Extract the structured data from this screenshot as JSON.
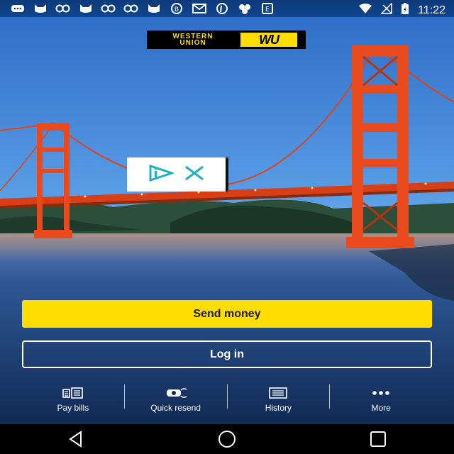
{
  "status_bar": {
    "time": "11:22",
    "notification_icons": [
      "message-icon",
      "cat-icon",
      "app-90-icon",
      "cat-icon",
      "app-90-icon",
      "app-90-icon",
      "cat-icon",
      "b-icon",
      "mail-icon",
      "pinterest-icon",
      "cluster-icon",
      "e-icon"
    ],
    "right_icons": [
      "wifi-icon",
      "signal-icon",
      "battery-icon"
    ]
  },
  "brand": {
    "logo_text_line1": "WESTERN",
    "logo_text_line2": "UNION",
    "logo_mark": "WU",
    "color": "#ffdd00"
  },
  "actions": {
    "send_money": "Send money",
    "log_in": "Log in"
  },
  "quick_actions": [
    {
      "label": "Pay bills",
      "icon": "bill-icon"
    },
    {
      "label": "Quick resend",
      "icon": "resend-icon"
    },
    {
      "label": "History",
      "icon": "history-icon"
    },
    {
      "label": "More",
      "icon": "more-dots-icon"
    }
  ],
  "ad_overlay": {
    "icons": [
      "adchoices-icon",
      "close-icon"
    ]
  },
  "nav_bar": {
    "icons": [
      "back-icon",
      "home-icon",
      "recents-icon"
    ]
  },
  "colors": {
    "accent": "#ffdd00",
    "sky": "#3e86d4",
    "bridge": "#e8491d"
  }
}
